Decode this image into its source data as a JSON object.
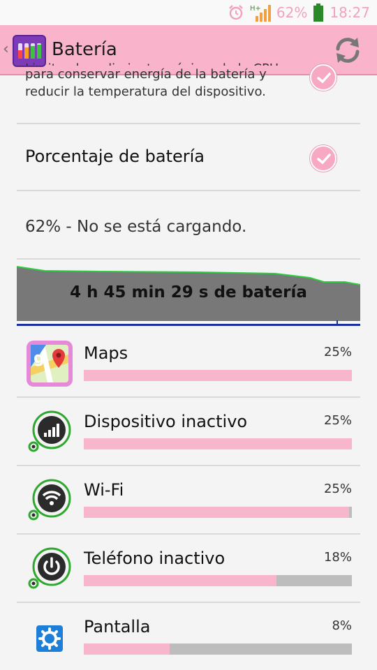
{
  "status_bar": {
    "battery_percent": "62%",
    "time": "18:27",
    "network": "H+",
    "icons": [
      "alarm-icon",
      "signal-icon",
      "battery-icon"
    ]
  },
  "action_bar": {
    "title": "Batería",
    "icons": [
      "back-caret-icon",
      "battery-app-icon",
      "refresh-icon"
    ]
  },
  "settings": {
    "power_saving_partial_text": "Limite el rendimiento máximo de la CPU",
    "power_saving_desc_line1": "para conservar energía de la batería y",
    "power_saving_desc_line2": "reducir la temperatura del dispositivo.",
    "power_saving_checked": true,
    "battery_percent_label": "Porcentaje de batería",
    "battery_percent_checked": true
  },
  "battery_status": "62% - No se está cargando.",
  "graph": {
    "label": "4 h 45 min 29 s de batería"
  },
  "usage": [
    {
      "name": "Maps",
      "percent": "25%",
      "fraction": 1.0,
      "icon": "maps-icon"
    },
    {
      "name": "Dispositivo inactivo",
      "percent": "25%",
      "fraction": 1.0,
      "icon": "cell-standby-icon"
    },
    {
      "name": "Wi-Fi",
      "percent": "25%",
      "fraction": 0.99,
      "icon": "wifi-icon"
    },
    {
      "name": "Teléfono inactivo",
      "percent": "18%",
      "fraction": 0.72,
      "icon": "power-icon"
    },
    {
      "name": "Pantalla",
      "percent": "8%",
      "fraction": 0.32,
      "icon": "display-settings-icon"
    }
  ],
  "colors": {
    "accent_pink": "#f9b4cc",
    "bar_fill": "#f7b6cc",
    "bar_track": "#bdbdbd",
    "graph_fill": "#787878",
    "graph_line": "#2ecc40"
  }
}
